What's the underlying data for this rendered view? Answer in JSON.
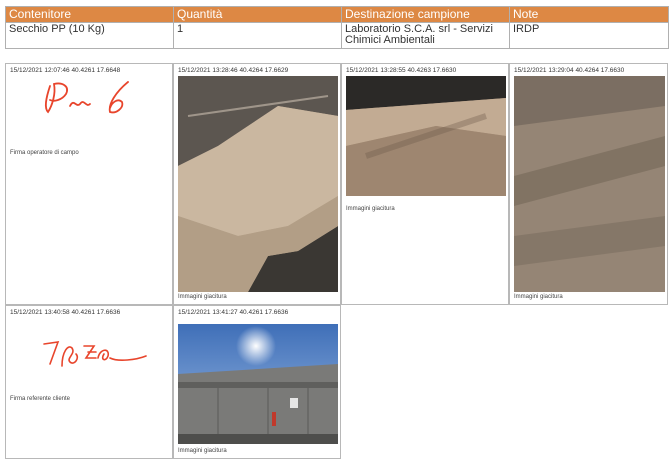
{
  "table": {
    "headers": [
      "Contenitore",
      "Quantità",
      "Destinazione campione",
      "Note"
    ],
    "row": [
      "Secchio PP (10 Kg)",
      "1",
      "Laboratorio S.C.A. srl - Servizi Chimici Ambientali",
      "IRDP"
    ]
  },
  "cells": [
    {
      "meta": "15/12/2021 12:07:46 40.4261 17.6648",
      "caption": "Firma operatore di campo",
      "kind": "signature"
    },
    {
      "meta": "15/12/2021 13:28:46 40.4264 17.6629",
      "caption": "Immagini giacitura",
      "kind": "photo"
    },
    {
      "meta": "15/12/2021 13:28:55 40.4263 17.6630",
      "caption": "Immagini giacitura",
      "kind": "photo"
    },
    {
      "meta": "15/12/2021 13:29:04 40.4264 17.6630",
      "caption": "Immagini giacitura",
      "kind": "photo"
    },
    {
      "meta": "15/12/2021 13:40:58 40.4261 17.6636",
      "caption": "Firma referente cliente",
      "kind": "signature"
    },
    {
      "meta": "15/12/2021 13:41:27 40.4261 17.6636",
      "caption": "Immagini giacitura",
      "kind": "photo"
    }
  ],
  "colors": {
    "header_bg": "#dd8844",
    "header_text": "#ffffff",
    "signature_ink": "#e8452c"
  }
}
